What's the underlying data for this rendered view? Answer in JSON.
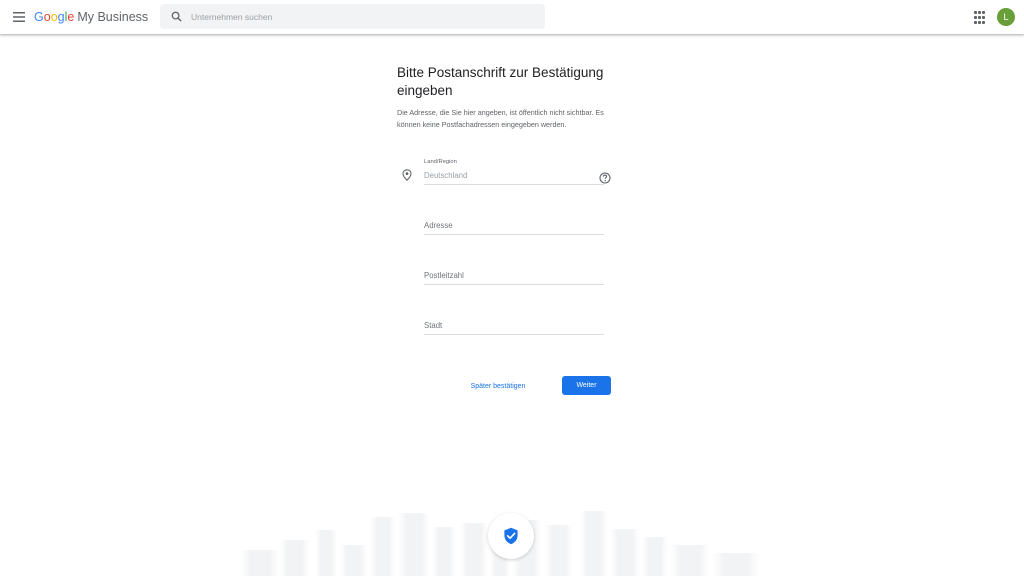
{
  "header": {
    "logo": {
      "g1": "G",
      "g2": "o",
      "g3": "o",
      "g4": "g",
      "g5": "l",
      "g6": "e",
      "product": "My Business"
    },
    "search_placeholder": "Unternehmen suchen",
    "avatar_letter": "L"
  },
  "form": {
    "title": "Bitte Postanschrift zur Bestätigung eingeben",
    "description": "Die Adresse, die Sie hier angeben, ist öffentlich nicht sichtbar. Es können keine Postfachadressen eingegeben werden.",
    "fields": [
      {
        "label": "Land/Region",
        "value": "",
        "placeholder": "Deutschland"
      },
      {
        "label": "",
        "value": "",
        "placeholder": "Adresse"
      },
      {
        "label": "",
        "value": "",
        "placeholder": "Postleitzahl"
      },
      {
        "label": "",
        "value": "",
        "placeholder": "Stadt"
      }
    ],
    "later_label": "Später bestätigen",
    "next_label": "Weiter"
  },
  "icons": {
    "menu": "menu-icon",
    "search": "search-icon",
    "apps": "apps-grid-icon",
    "location": "location-pin-icon",
    "help": "help-circle-icon",
    "verified": "verified-shield-icon"
  },
  "colors": {
    "primary": "#1a73e8",
    "avatar": "#689f38",
    "search_bg": "#f1f3f4"
  }
}
